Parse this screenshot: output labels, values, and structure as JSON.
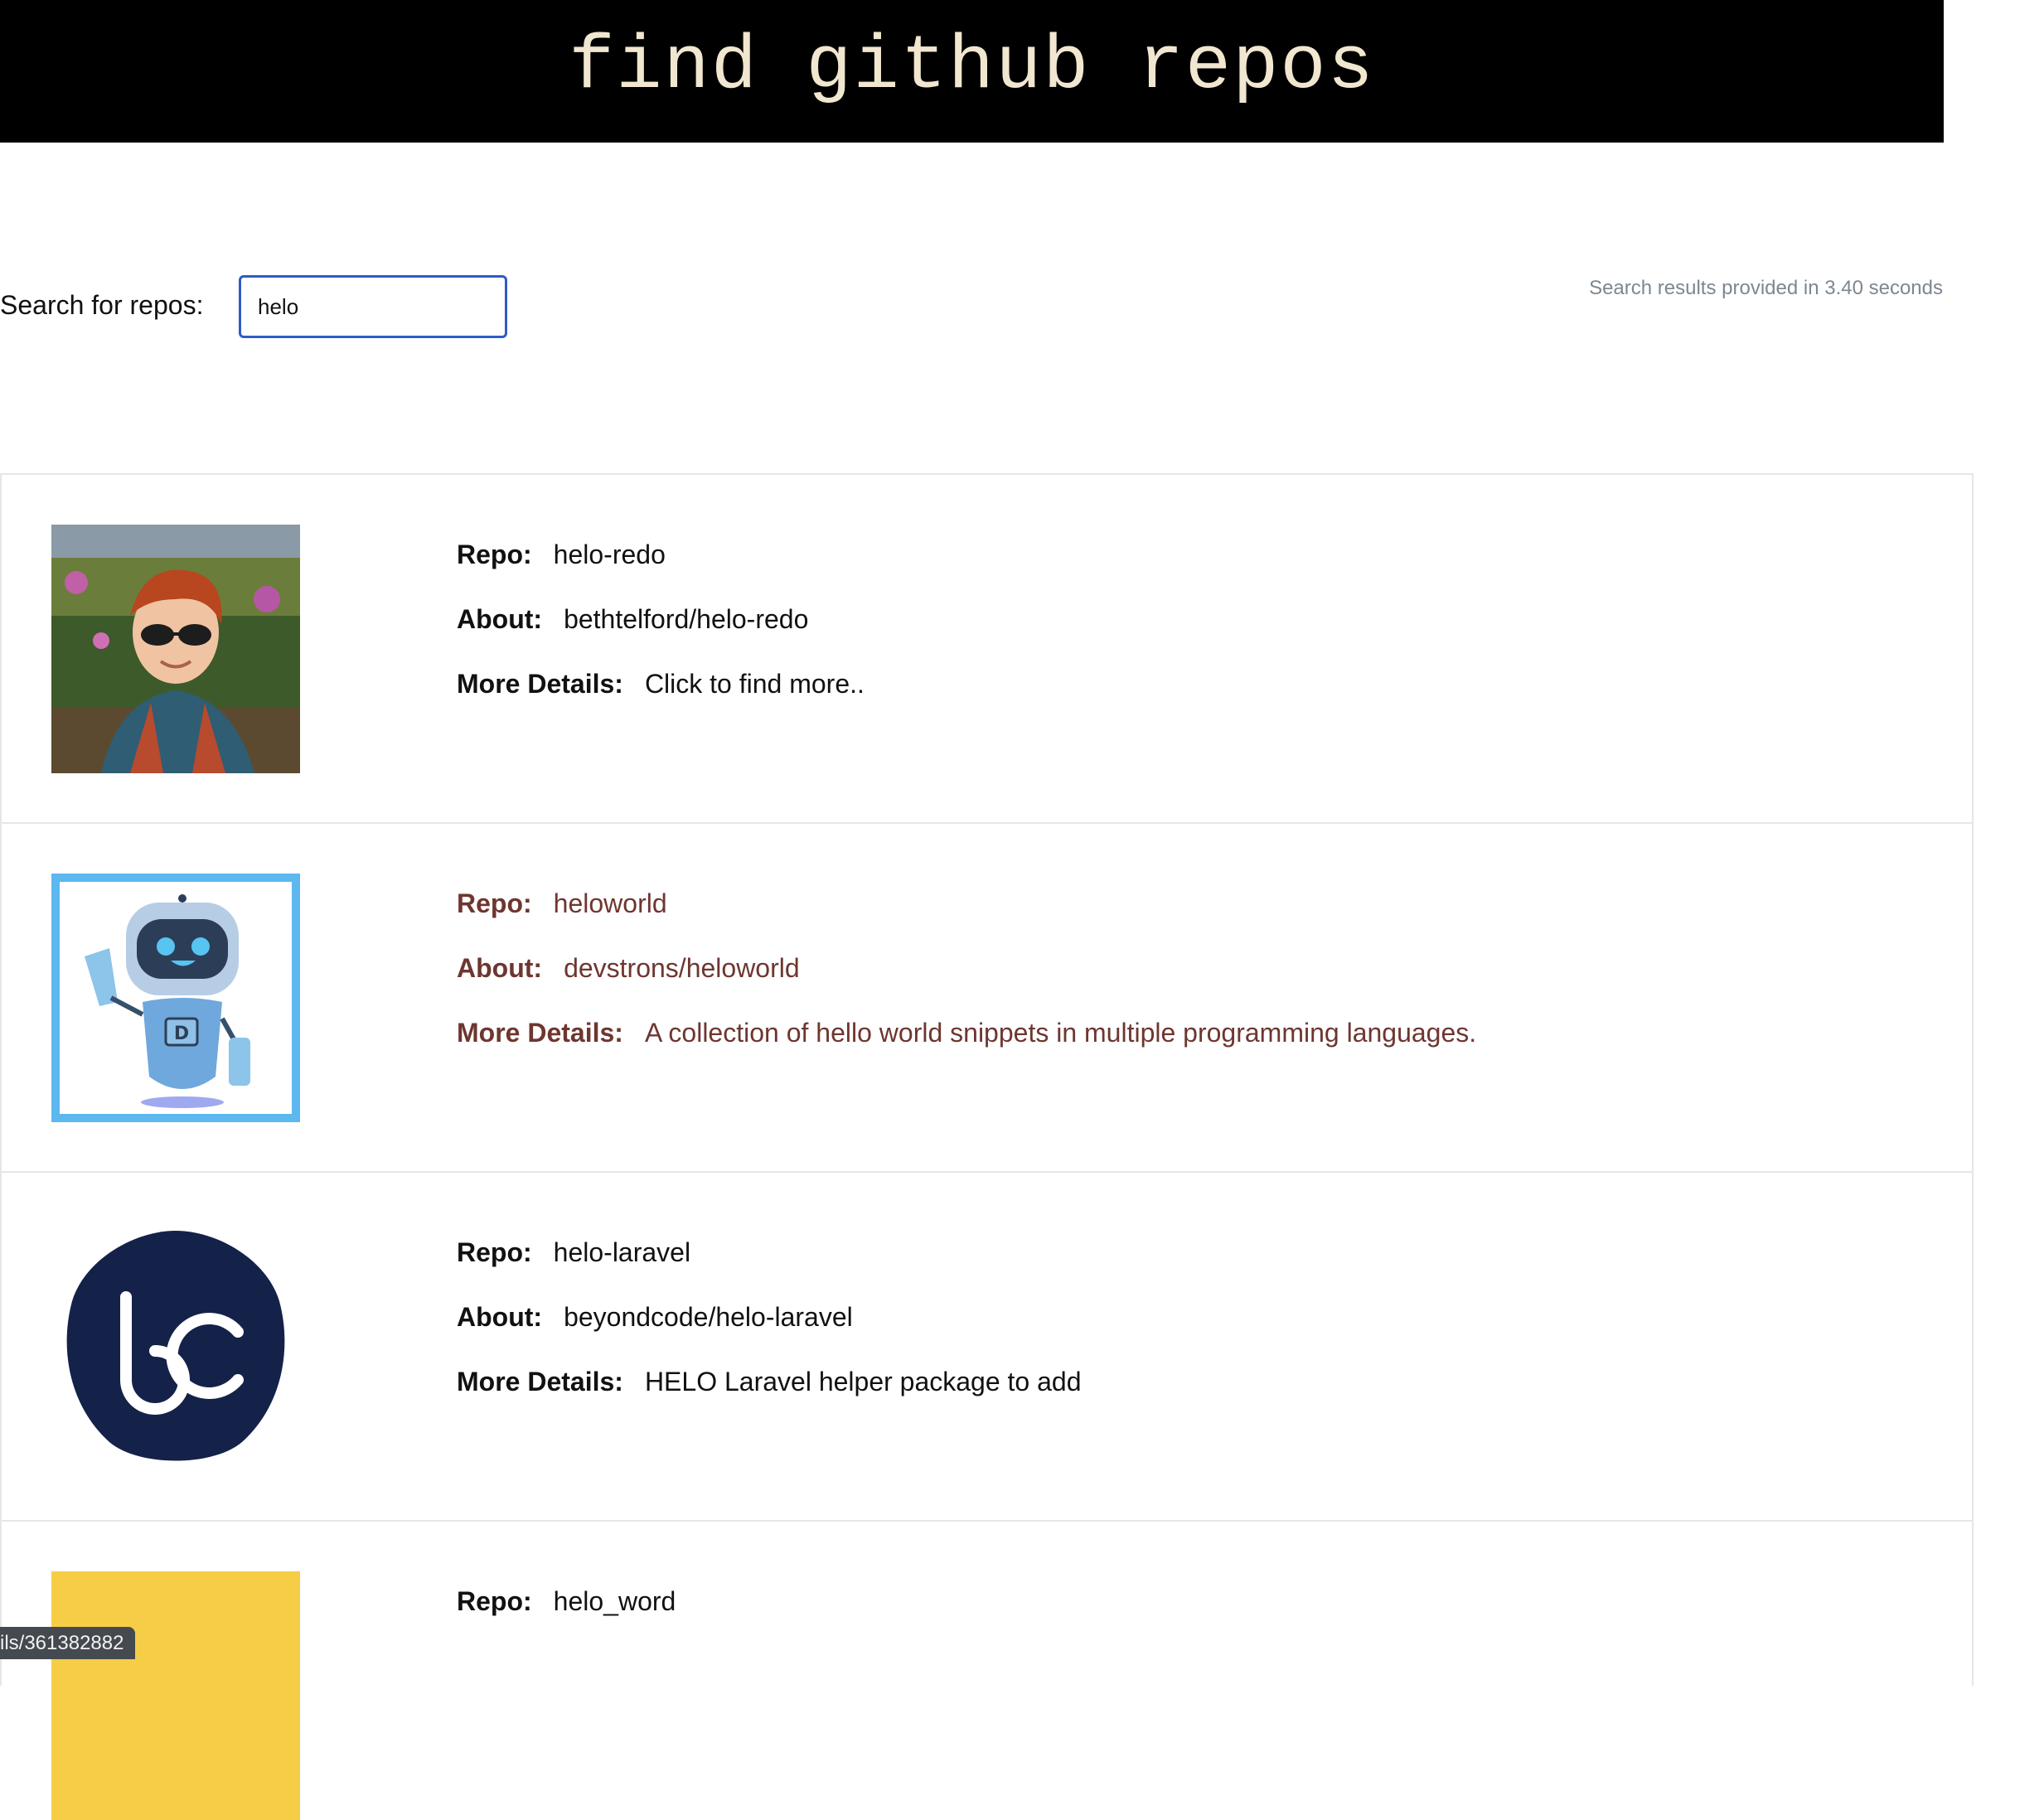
{
  "header": {
    "title": "find github repos"
  },
  "search": {
    "label": "Search for repos:",
    "value": "helo",
    "timing_text": "Search results provided in 3.40 seconds"
  },
  "labels": {
    "repo": "Repo:",
    "about": "About:",
    "more": "More Details:"
  },
  "results": [
    {
      "avatar": "person-photo",
      "repo": "helo-redo",
      "about": "bethtelford/helo-redo",
      "more": "Click to find more.."
    },
    {
      "avatar": "robot-logo",
      "repo": "heloworld",
      "about": "devstrons/heloworld",
      "more": "A collection of hello world snippets in multiple programming languages."
    },
    {
      "avatar": "bc-logo",
      "repo": "helo-laravel",
      "about": "beyondcode/helo-laravel",
      "more": "HELO Laravel helper package to add"
    },
    {
      "avatar": "yellow-logo",
      "repo": "helo_word",
      "about": "",
      "more": ""
    }
  ],
  "status_bar": {
    "url": "ils/361382882"
  },
  "colors": {
    "header_bg": "#000000",
    "header_text": "#f1e6cf",
    "input_border": "#2f5cc4",
    "hover_text": "#6e3630",
    "muted": "#7d8791"
  }
}
